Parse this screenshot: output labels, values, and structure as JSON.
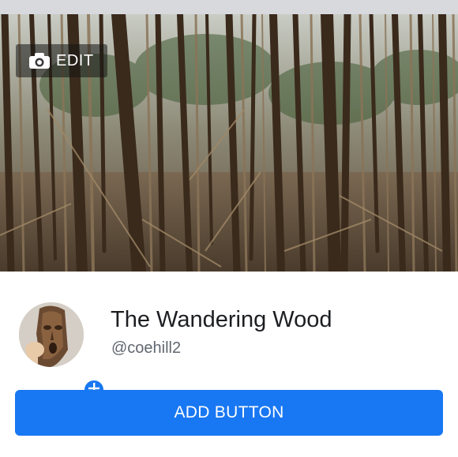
{
  "cover": {
    "edit_label": "EDIT",
    "edit_icon": "camera-icon"
  },
  "profile": {
    "name": "The Wandering Wood",
    "handle": "@coehill2",
    "add_photo_icon": "plus-icon"
  },
  "actions": {
    "add_button_label": "ADD BUTTON"
  },
  "colors": {
    "accent": "#1877f2",
    "top_strip": "#d7d9dd",
    "name_text": "#1c1e21",
    "handle_text": "#606770"
  }
}
